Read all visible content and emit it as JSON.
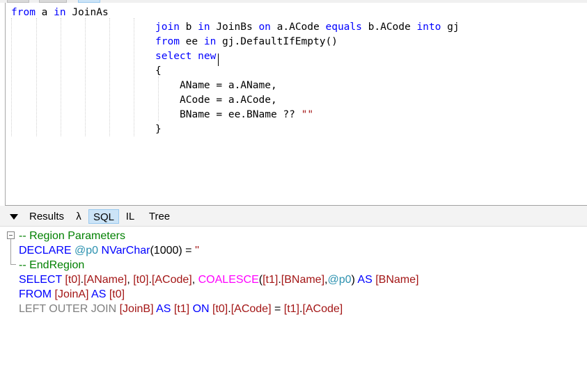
{
  "editor": {
    "lines": [
      [
        {
          "t": "from",
          "c": "kw"
        },
        {
          "t": " a "
        },
        {
          "t": "in",
          "c": "kw"
        },
        {
          "t": " JoinAs"
        }
      ],
      [
        {
          "t": "join",
          "c": "kw"
        },
        {
          "t": " b "
        },
        {
          "t": "in",
          "c": "kw"
        },
        {
          "t": " JoinBs "
        },
        {
          "t": "on",
          "c": "kw"
        },
        {
          "t": " a.ACode "
        },
        {
          "t": "equals",
          "c": "kw"
        },
        {
          "t": " b.ACode "
        },
        {
          "t": "into",
          "c": "kw"
        },
        {
          "t": " gj"
        }
      ],
      [
        {
          "t": "from",
          "c": "kw"
        },
        {
          "t": " ee "
        },
        {
          "t": "in",
          "c": "kw"
        },
        {
          "t": " gj.DefaultIfEmpty()"
        }
      ],
      [
        {
          "t": "select",
          "c": "kw"
        },
        {
          "t": " "
        },
        {
          "t": "new",
          "c": "kw"
        }
      ],
      [
        {
          "t": "{"
        }
      ],
      [
        {
          "t": "AName = a.AName,"
        }
      ],
      [
        {
          "t": "ACode = a.ACode,"
        }
      ],
      [
        {
          "t": "BName = ee.BName ?? "
        },
        {
          "t": "\"\"",
          "c": "str"
        }
      ],
      [
        {
          "t": "}"
        }
      ]
    ]
  },
  "results_tabs": {
    "results": "Results",
    "lambda": "λ",
    "sql": "SQL",
    "il": "IL",
    "tree": "Tree"
  },
  "sql": {
    "lines": [
      [
        {
          "t": "-- Region Parameters",
          "c": "c-comment"
        }
      ],
      [
        {
          "t": "DECLARE "
        },
        {
          "t": "@p0",
          "c": "c-param"
        },
        {
          "t": " NVarChar"
        },
        {
          "t": "(",
          "c": "c-black"
        },
        {
          "t": "1000",
          "c": "c-black"
        },
        {
          "t": ")",
          "c": "c-black"
        },
        {
          "t": " = ",
          "c": "c-black"
        },
        {
          "t": "''",
          "c": "c-str"
        }
      ],
      [
        {
          "t": "-- EndRegion",
          "c": "c-comment"
        }
      ],
      [
        {
          "t": "SELECT "
        },
        {
          "t": "[t0]",
          "c": "c-ident"
        },
        {
          "t": ".",
          "c": "c-black"
        },
        {
          "t": "[AName]",
          "c": "c-ident"
        },
        {
          "t": ", ",
          "c": "c-black"
        },
        {
          "t": "[t0]",
          "c": "c-ident"
        },
        {
          "t": ".",
          "c": "c-black"
        },
        {
          "t": "[ACode]",
          "c": "c-ident"
        },
        {
          "t": ", ",
          "c": "c-black"
        },
        {
          "t": "COALESCE",
          "c": "c-func"
        },
        {
          "t": "(",
          "c": "c-black"
        },
        {
          "t": "[t1]",
          "c": "c-ident"
        },
        {
          "t": ".",
          "c": "c-black"
        },
        {
          "t": "[BName]",
          "c": "c-ident"
        },
        {
          "t": ",",
          "c": "c-black"
        },
        {
          "t": "@p0",
          "c": "c-param"
        },
        {
          "t": ")",
          "c": "c-black"
        },
        {
          "t": " AS "
        },
        {
          "t": "[BName]",
          "c": "c-ident"
        }
      ],
      [
        {
          "t": "FROM "
        },
        {
          "t": "[JoinA]",
          "c": "c-ident"
        },
        {
          "t": " AS "
        },
        {
          "t": "[t0]",
          "c": "c-ident"
        }
      ],
      [
        {
          "t": "LEFT OUTER JOIN ",
          "c": "c-gray"
        },
        {
          "t": "[JoinB]",
          "c": "c-ident"
        },
        {
          "t": " AS "
        },
        {
          "t": "[t1]",
          "c": "c-ident"
        },
        {
          "t": " ON "
        },
        {
          "t": "[t0]",
          "c": "c-ident"
        },
        {
          "t": ".",
          "c": "c-black"
        },
        {
          "t": "[ACode]",
          "c": "c-ident"
        },
        {
          "t": " = ",
          "c": "c-black"
        },
        {
          "t": "[t1]",
          "c": "c-ident"
        },
        {
          "t": ".",
          "c": "c-black"
        },
        {
          "t": "[ACode]",
          "c": "c-ident"
        }
      ]
    ]
  }
}
